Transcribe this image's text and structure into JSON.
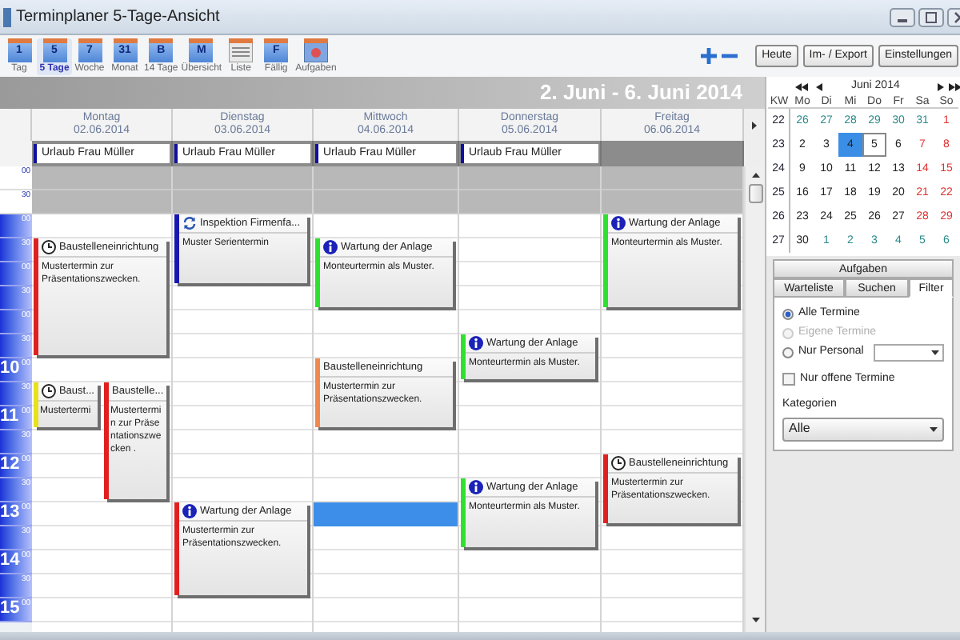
{
  "window": {
    "title": "Terminplaner 5-Tage-Ansicht"
  },
  "views": [
    {
      "kind": "calendar",
      "icon_text": "1",
      "label": "Tag",
      "selected": false
    },
    {
      "kind": "calendar",
      "icon_text": "5",
      "label": "5 Tage",
      "selected": true
    },
    {
      "kind": "calendar",
      "icon_text": "7",
      "label": "Woche",
      "selected": false
    },
    {
      "kind": "calendar",
      "icon_text": "31",
      "label": "Monat",
      "selected": false
    },
    {
      "kind": "calendar",
      "icon_text": "B",
      "label": "14 Tage",
      "selected": false
    },
    {
      "kind": "calendar",
      "icon_text": "M",
      "label": "Übersicht",
      "selected": false
    },
    {
      "kind": "list",
      "label": "Liste",
      "selected": false
    },
    {
      "kind": "calendar",
      "icon_text": "F",
      "label": "Fällig",
      "selected": false
    },
    {
      "kind": "tasks",
      "label": "Aufgaben",
      "selected": false
    }
  ],
  "buttons": [
    "Heute",
    "Im- / Export",
    "Einstellungen"
  ],
  "range_title": "2. Juni - 6. Juni 2014",
  "time_slots": [
    {
      "minute": "00",
      "working": false
    },
    {
      "minute": "30",
      "working": false
    },
    {
      "minute": "00",
      "working": true
    },
    {
      "minute": "30",
      "working": true
    },
    {
      "minute": "00",
      "working": true
    },
    {
      "minute": "30",
      "working": true
    },
    {
      "minute": "00",
      "working": true
    },
    {
      "minute": "30",
      "working": true
    },
    {
      "hour": "10",
      "minute": "00",
      "working": true
    },
    {
      "minute": "30",
      "working": true
    },
    {
      "hour": "11",
      "minute": "00",
      "working": true
    },
    {
      "minute": "30",
      "working": true
    },
    {
      "hour": "12",
      "minute": "00",
      "working": true
    },
    {
      "minute": "30",
      "working": true
    },
    {
      "hour": "13",
      "minute": "00",
      "working": true
    },
    {
      "minute": "30",
      "working": true
    },
    {
      "hour": "14",
      "minute": "00",
      "working": true
    },
    {
      "minute": "30",
      "working": true
    },
    {
      "hour": "15",
      "minute": "00",
      "working": true
    }
  ],
  "days": [
    {
      "weekday": "Montag",
      "date": "02.06.2014",
      "selection": false,
      "all_day": [
        {
          "title": "Urlaub Frau Müller",
          "color": "#1010a0"
        }
      ],
      "events": [
        {
          "title": "Baustelleneinrichtung",
          "text": "Mustertermin zur Präsentationszwecken.",
          "kind": "clock",
          "color": "#e02020"
        },
        {
          "title": "Baust...",
          "text": "Mustertermi",
          "kind": "clock",
          "color": "#e8e020"
        },
        {
          "title": "Baustelle...",
          "text": "Mustertermin zur Präsentationszwecken .",
          "kind": "none",
          "color": "#e02020"
        }
      ]
    },
    {
      "weekday": "Dienstag",
      "date": "03.06.2014",
      "selection": false,
      "all_day": [
        {
          "title": "Urlaub Frau Müller",
          "color": "#1010a0"
        }
      ],
      "events": [
        {
          "title": "Inspektion Firmenfa...",
          "text": "Muster Serientermin",
          "kind": "recurring",
          "color": "#1818b0"
        },
        {
          "title": "Wartung der Anlage",
          "text": "Mustertermin zur Präsentationszwecken.",
          "kind": "info",
          "color": "#e02020"
        }
      ]
    },
    {
      "weekday": "Mittwoch",
      "date": "04.06.2014",
      "selection": true,
      "all_day": [
        {
          "title": "Urlaub Frau Müller",
          "color": "#1010a0"
        }
      ],
      "events": [
        {
          "title": "Wartung der Anlage",
          "text": "Monteurtermin als Muster.",
          "kind": "info",
          "color": "#30e030"
        },
        {
          "title": "Baustelleneinrichtung",
          "text": "Mustertermin zur Präsentationszwecken.",
          "kind": "none",
          "color": "#f08850"
        }
      ]
    },
    {
      "weekday": "Donnerstag",
      "date": "05.06.2014",
      "selection": false,
      "all_day": [
        {
          "title": "Urlaub Frau Müller",
          "color": "#1010a0"
        }
      ],
      "events": [
        {
          "title": "Wartung der Anlage",
          "text": "Monteurtermin als Muster.",
          "kind": "info",
          "color": "#30e030"
        },
        {
          "title": "Wartung der Anlage",
          "text": "Monteurtermin als Muster.",
          "kind": "info",
          "color": "#30e030"
        }
      ]
    },
    {
      "weekday": "Freitag",
      "date": "06.06.2014",
      "selection": false,
      "events": [
        {
          "title": "Wartung der Anlage",
          "text": "Monteurtermin als Muster.",
          "kind": "info",
          "color": "#30e030"
        },
        {
          "title": "Baustelleneinrichtung",
          "text": "Mustertermin zur Präsentationszwecken.",
          "kind": "clock",
          "color": "#e02020"
        }
      ]
    }
  ],
  "mini_calendar": {
    "title": "Juni 2014",
    "headers": [
      "KW",
      "Mo",
      "Di",
      "Mi",
      "Do",
      "Fr",
      "Sa",
      "So"
    ],
    "weeks": [
      {
        "kw": "22",
        "days": [
          {
            "day": "26",
            "kind": "other",
            "selected": false,
            "today": false
          },
          {
            "day": "27",
            "kind": "other",
            "selected": false,
            "today": false
          },
          {
            "day": "28",
            "kind": "other",
            "selected": false,
            "today": false
          },
          {
            "day": "29",
            "kind": "other",
            "selected": false,
            "today": false
          },
          {
            "day": "30",
            "kind": "other",
            "selected": false,
            "today": false
          },
          {
            "day": "31",
            "kind": "other",
            "selected": false,
            "today": false
          },
          {
            "day": "1",
            "kind": "weekend",
            "selected": false,
            "today": false
          }
        ]
      },
      {
        "kw": "23",
        "days": [
          {
            "day": "2",
            "kind": "normal",
            "selected": false,
            "today": false
          },
          {
            "day": "3",
            "kind": "normal",
            "selected": false,
            "today": false
          },
          {
            "day": "4",
            "kind": "normal",
            "selected": true,
            "today": false
          },
          {
            "day": "5",
            "kind": "normal",
            "selected": false,
            "today": true
          },
          {
            "day": "6",
            "kind": "normal",
            "selected": false,
            "today": false
          },
          {
            "day": "7",
            "kind": "weekend",
            "selected": false,
            "today": false
          },
          {
            "day": "8",
            "kind": "weekend",
            "selected": false,
            "today": false
          }
        ]
      },
      {
        "kw": "24",
        "days": [
          {
            "day": "9",
            "kind": "normal",
            "selected": false,
            "today": false
          },
          {
            "day": "10",
            "kind": "normal",
            "selected": false,
            "today": false
          },
          {
            "day": "11",
            "kind": "normal",
            "selected": false,
            "today": false
          },
          {
            "day": "12",
            "kind": "normal",
            "selected": false,
            "today": false
          },
          {
            "day": "13",
            "kind": "normal",
            "selected": false,
            "today": false
          },
          {
            "day": "14",
            "kind": "weekend",
            "selected": false,
            "today": false
          },
          {
            "day": "15",
            "kind": "weekend",
            "selected": false,
            "today": false
          }
        ]
      },
      {
        "kw": "25",
        "days": [
          {
            "day": "16",
            "kind": "normal",
            "selected": false,
            "today": false
          },
          {
            "day": "17",
            "kind": "normal",
            "selected": false,
            "today": false
          },
          {
            "day": "18",
            "kind": "normal",
            "selected": false,
            "today": false
          },
          {
            "day": "19",
            "kind": "normal",
            "selected": false,
            "today": false
          },
          {
            "day": "20",
            "kind": "normal",
            "selected": false,
            "today": false
          },
          {
            "day": "21",
            "kind": "weekend",
            "selected": false,
            "today": false
          },
          {
            "day": "22",
            "kind": "weekend",
            "selected": false,
            "today": false
          }
        ]
      },
      {
        "kw": "26",
        "days": [
          {
            "day": "23",
            "kind": "normal",
            "selected": false,
            "today": false
          },
          {
            "day": "24",
            "kind": "normal",
            "selected": false,
            "today": false
          },
          {
            "day": "25",
            "kind": "normal",
            "selected": false,
            "today": false
          },
          {
            "day": "26",
            "kind": "normal",
            "selected": false,
            "today": false
          },
          {
            "day": "27",
            "kind": "normal",
            "selected": false,
            "today": false
          },
          {
            "day": "28",
            "kind": "weekend",
            "selected": false,
            "today": false
          },
          {
            "day": "29",
            "kind": "weekend",
            "selected": false,
            "today": false
          }
        ]
      },
      {
        "kw": "27",
        "days": [
          {
            "day": "30",
            "kind": "normal",
            "selected": false,
            "today": false
          },
          {
            "day": "1",
            "kind": "other",
            "selected": false,
            "today": false
          },
          {
            "day": "2",
            "kind": "other",
            "selected": false,
            "today": false
          },
          {
            "day": "3",
            "kind": "other",
            "selected": false,
            "today": false
          },
          {
            "day": "4",
            "kind": "other",
            "selected": false,
            "today": false
          },
          {
            "day": "5",
            "kind": "other",
            "selected": false,
            "today": false
          },
          {
            "day": "6",
            "kind": "other",
            "selected": false,
            "today": false
          }
        ]
      }
    ]
  },
  "panel_tabs": [
    {
      "label": "Aufgaben",
      "selected": false
    },
    {
      "label": "Warteliste",
      "selected": false
    },
    {
      "label": "Suchen",
      "selected": false
    },
    {
      "label": "Filter",
      "selected": true
    }
  ],
  "filter": {
    "radios": [
      {
        "label": "Alle Termine",
        "selected": true,
        "disabled": false
      },
      {
        "label": "Eigene Termine",
        "selected": false,
        "disabled": true
      },
      {
        "label": "Nur Personal",
        "selected": false,
        "disabled": false,
        "kind": "with-select"
      }
    ],
    "checkbox": {
      "label": "Nur offene Termine",
      "checked": false
    },
    "categories": {
      "label": "Kategorien",
      "value": "Alle"
    }
  }
}
